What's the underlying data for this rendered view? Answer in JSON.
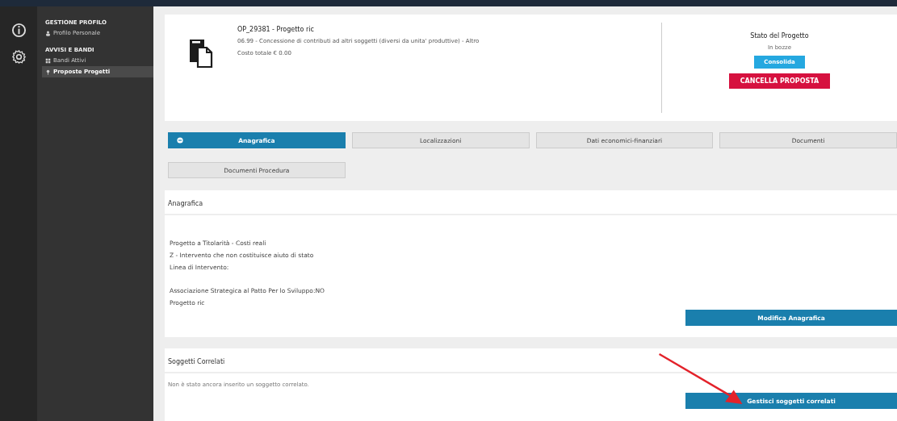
{
  "sidebar": {
    "sections": [
      {
        "title": "GESTIONE PROFILO",
        "items": [
          {
            "label": "Profilo Personale",
            "kind": "user",
            "selected": false
          }
        ]
      },
      {
        "title": "AVVISI E BANDI",
        "items": [
          {
            "label": "Bandi Attivi",
            "kind": "grid",
            "selected": false
          },
          {
            "label": "Proposte Progetti",
            "kind": "pin",
            "selected": true
          }
        ]
      }
    ]
  },
  "project": {
    "title": "OP_29381 - Progetto ric",
    "description": "06.99 - Concessione di contributi ad altri soggetti (diversi da unita' produttive) - Altro",
    "cost": "Costo totale € 0.00"
  },
  "status": {
    "heading": "Stato del Progetto",
    "value": "In bozze",
    "buttons": [
      {
        "label": "Consolida",
        "kind": "primary"
      },
      {
        "label": "CANCELLA PROPOSTA",
        "kind": "danger"
      }
    ]
  },
  "tabs": [
    {
      "label": "Anagrafica",
      "selected": true
    },
    {
      "label": "Localizzazioni",
      "selected": false
    },
    {
      "label": "Dati economici-finanziari",
      "selected": false
    },
    {
      "label": "Documenti",
      "selected": false
    },
    {
      "label": "Documenti Procedura",
      "selected": false
    }
  ],
  "anagrafica": {
    "title": "Anagrafica",
    "line_groups": [
      [
        "Progetto a Titolarità - Costi reali",
        "Z - Intervento che non costituisce aiuto di stato",
        "Linea di Intervento:"
      ],
      [
        "Associazione Strategica al Patto Per lo Sviluppo:NO",
        "Progetto ric"
      ]
    ],
    "button": "Modifica Anagrafica"
  },
  "soggetti": {
    "title": "Soggetti Correlati",
    "message": "Non è stato ancora inserito un soggetto correlato.",
    "button": "Gestisci soggetti correlati"
  }
}
